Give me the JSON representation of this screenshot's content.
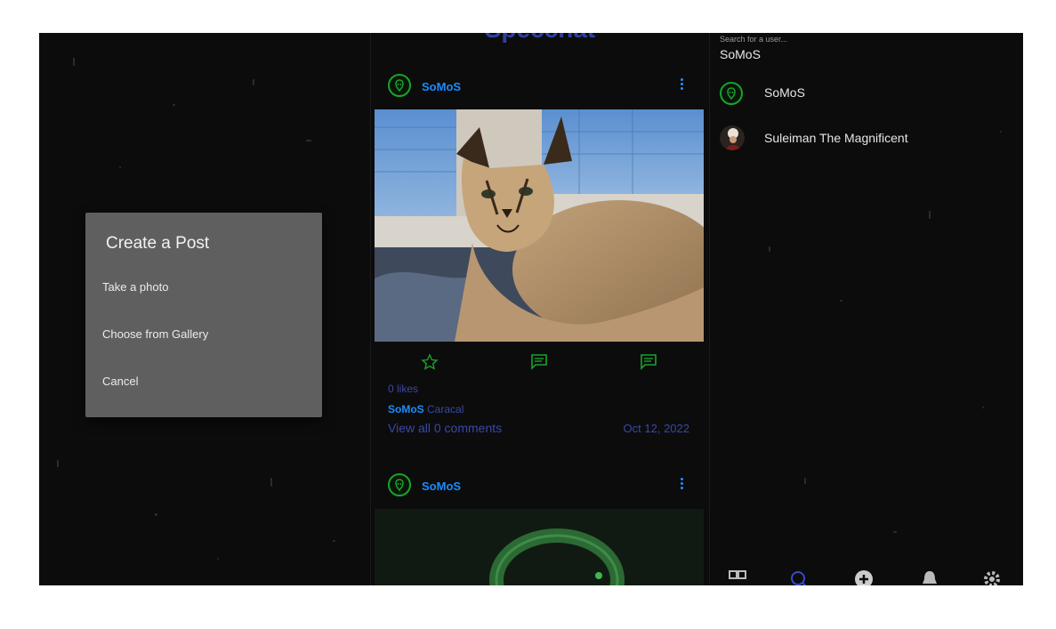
{
  "feed": {
    "app_title": "Specchat",
    "posts": [
      {
        "author": "SoMoS",
        "likes": "0 likes",
        "caption_user": "SoMoS",
        "caption_text": "Caracal",
        "comments_link": "View all 0 comments",
        "date": "Oct 12, 2022"
      },
      {
        "author": "SoMoS"
      }
    ],
    "icons": [
      "star-outline-icon",
      "comment-icon",
      "comment-icon"
    ]
  },
  "dialog": {
    "title": "Create a Post",
    "options": [
      "Take a photo",
      "Choose from Gallery",
      "Cancel"
    ]
  },
  "search": {
    "placeholder": "Search for a user...",
    "value": "SoMoS",
    "results": [
      {
        "name": "SoMoS"
      },
      {
        "name": "Suleiman The Magnificent"
      }
    ]
  },
  "bottom_nav": [
    "home-icon",
    "search-icon",
    "add-icon",
    "notifications-icon",
    "settings-icon"
  ],
  "colors": {
    "background": "#0c0c0c",
    "accent_blue": "#1a8cff",
    "muted_blue": "#3a48a8",
    "accent_green": "#17a42b",
    "dialog_bg": "#5f5f5f"
  }
}
